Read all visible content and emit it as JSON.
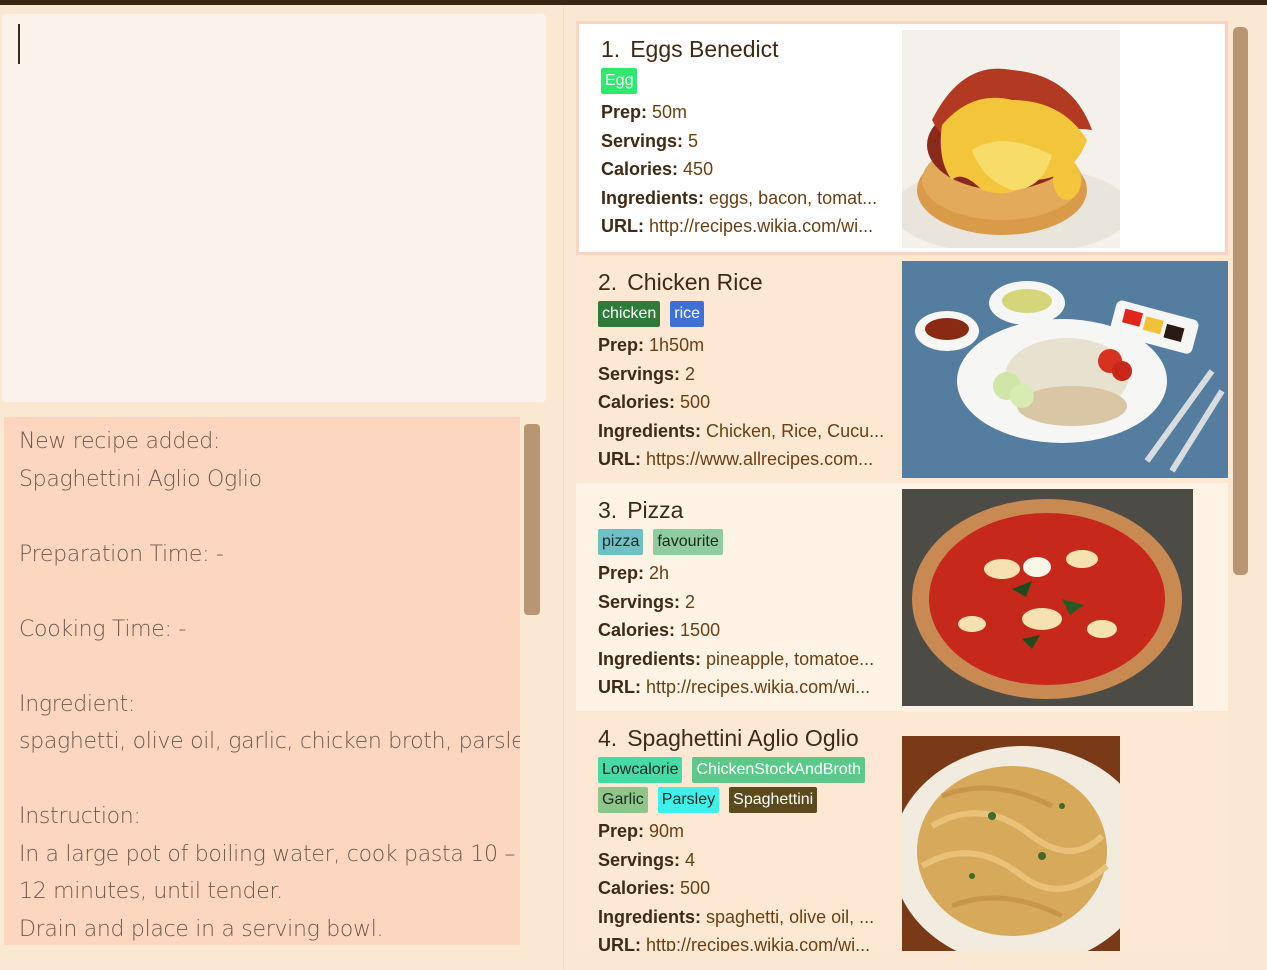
{
  "command": {
    "value": ""
  },
  "result": {
    "lines": [
      "New recipe added:",
      "Spaghettini Aglio Oglio",
      "",
      "Preparation Time: -",
      "",
      "Cooking Time: -",
      "",
      "Ingredient:",
      "spaghetti, olive oil, garlic, chicken broth, parsley",
      "",
      "Instruction:",
      "In a large pot of boiling water, cook pasta 10 –",
      "12 minutes, until tender.",
      "Drain and place in a serving bowl."
    ]
  },
  "labels": {
    "prep": "Prep:",
    "servings": "Servings:",
    "calories": "Calories:",
    "ingredients": "Ingredients:",
    "url": "URL:"
  },
  "recipes": [
    {
      "index": "1.",
      "name": "Eggs Benedict",
      "tags": [
        [
          {
            "text": "Egg",
            "color": "#2ee870",
            "fg": "#ffffff"
          }
        ]
      ],
      "prep": "50m",
      "servings": "5",
      "calories": "450",
      "ingredients": "eggs, bacon, tomat...",
      "url": "http://recipes.wikia.com/wi...",
      "selected": true,
      "image": "eggs-benedict-photo"
    },
    {
      "index": "2.",
      "name": "Chicken Rice",
      "tags": [
        [
          {
            "text": "chicken",
            "color": "#2e7b3a",
            "fg": "#ffffff"
          },
          {
            "text": "rice",
            "color": "#3f6fd8",
            "fg": "#ffffff"
          }
        ]
      ],
      "prep": "1h50m",
      "servings": "2",
      "calories": "500",
      "ingredients": "Chicken, Rice, Cucu...",
      "url": "https://www.allrecipes.com...",
      "selected": false,
      "image": "chicken-rice-photo"
    },
    {
      "index": "3.",
      "name": "Pizza",
      "tags": [
        [
          {
            "text": "pizza",
            "color": "#6fbfc4",
            "fg": "#1a2a2a"
          },
          {
            "text": "favourite",
            "color": "#8fcc9f",
            "fg": "#1a2a1a"
          }
        ]
      ],
      "prep": "2h",
      "servings": "2",
      "calories": "1500",
      "ingredients": "pineapple, tomatoe...",
      "url": "http://recipes.wikia.com/wi...",
      "selected": false,
      "image": "pizza-photo"
    },
    {
      "index": "4.",
      "name": "Spaghettini Aglio Oglio",
      "tags": [
        [
          {
            "text": "Lowcalorie",
            "color": "#47d9a6",
            "fg": "#102a20"
          },
          {
            "text": "ChickenStockAndBroth",
            "color": "#5bc98a",
            "fg": "#ffffff"
          }
        ],
        [
          {
            "text": "Garlic",
            "color": "#8fc48a",
            "fg": "#1a2a1a"
          },
          {
            "text": "Parsley",
            "color": "#3ff0e8",
            "fg": "#102a2a"
          },
          {
            "text": "Spaghettini",
            "color": "#5a4a1e",
            "fg": "#ffffff"
          }
        ]
      ],
      "prep": "90m",
      "servings": "4",
      "calories": "500",
      "ingredients": "spaghetti, olive oil, ...",
      "url": "http://recipes.wikia.com/wi...",
      "selected": false,
      "image": "spaghettini-photo"
    }
  ],
  "colors": {
    "background": "#fae8d2",
    "result_bg": "#fdd6bf",
    "command_bg": "#fbf2ec",
    "selected_border": "#fcd3c0",
    "scrollbar": "#b89573"
  }
}
